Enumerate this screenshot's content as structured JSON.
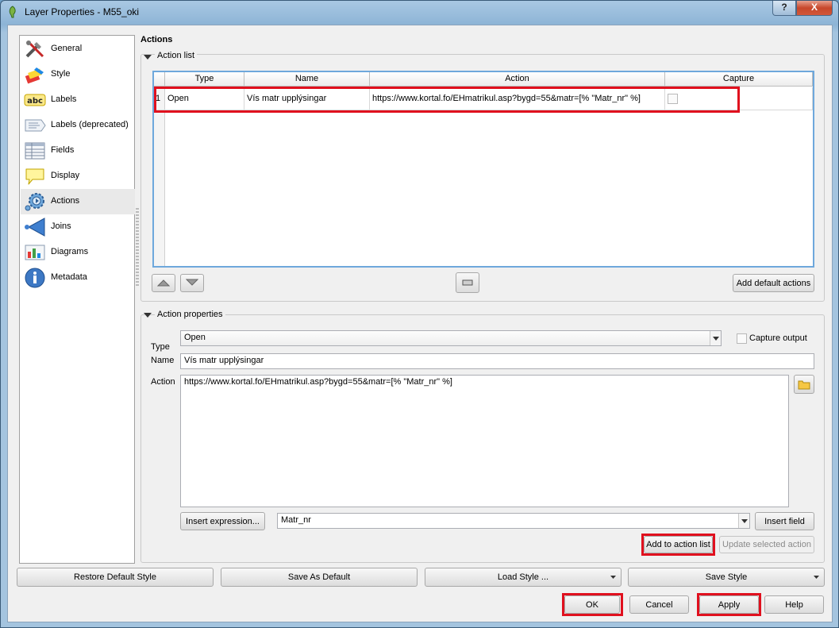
{
  "window": {
    "title": "Layer Properties - M55_oki",
    "help_glyph": "?",
    "close_glyph": "X"
  },
  "sidebar": {
    "items": [
      {
        "label": "General",
        "icon": "general-tools-icon",
        "selected": false
      },
      {
        "label": "Style",
        "icon": "style-brush-icon",
        "selected": false
      },
      {
        "label": "Labels",
        "icon": "labels-abc-icon",
        "selected": false
      },
      {
        "label": "Labels (deprecated)",
        "icon": "labels-deprecated-icon",
        "selected": false
      },
      {
        "label": "Fields",
        "icon": "fields-table-icon",
        "selected": false
      },
      {
        "label": "Display",
        "icon": "display-bubble-icon",
        "selected": false
      },
      {
        "label": "Actions",
        "icon": "actions-gear-icon",
        "selected": true
      },
      {
        "label": "Joins",
        "icon": "joins-arrow-icon",
        "selected": false
      },
      {
        "label": "Diagrams",
        "icon": "diagrams-chart-icon",
        "selected": false
      },
      {
        "label": "Metadata",
        "icon": "metadata-info-icon",
        "selected": false
      }
    ]
  },
  "actions": {
    "title": "Actions",
    "action_list": {
      "title": "Action list",
      "columns": [
        "Type",
        "Name",
        "Action",
        "Capture"
      ],
      "rows": [
        {
          "index": "1",
          "type": "Open",
          "name": "Vís matr upplýsingar",
          "action": "https://www.kortal.fo/EHmatrikul.asp?bygd=55&matr=[% \"Matr_nr\" %]",
          "capture": false
        }
      ],
      "add_default_label": "Add default actions"
    },
    "properties": {
      "title": "Action properties",
      "type_label": "Type",
      "type_value": "Open",
      "capture_output_label": "Capture output",
      "capture_output_checked": false,
      "name_label": "Name",
      "name_value": "Vís matr upplýsingar",
      "action_label": "Action",
      "action_value": "https://www.kortal.fo/EHmatrikul.asp?bygd=55&matr=[% \"Matr_nr\" %]",
      "insert_expression_label": "Insert expression...",
      "field_value": "Matr_nr",
      "insert_field_label": "Insert field",
      "add_to_list_label": "Add to action list",
      "update_selected_label": "Update selected action"
    }
  },
  "footer": {
    "restore_default_label": "Restore Default Style",
    "save_default_label": "Save As Default",
    "load_style_label": "Load Style ...",
    "save_style_label": "Save Style",
    "ok_label": "OK",
    "cancel_label": "Cancel",
    "apply_label": "Apply",
    "help_label": "Help"
  },
  "colors": {
    "highlight_red": "#e0101e",
    "table_border": "#6ea8dc",
    "selected_item": "#e9e9e9"
  }
}
